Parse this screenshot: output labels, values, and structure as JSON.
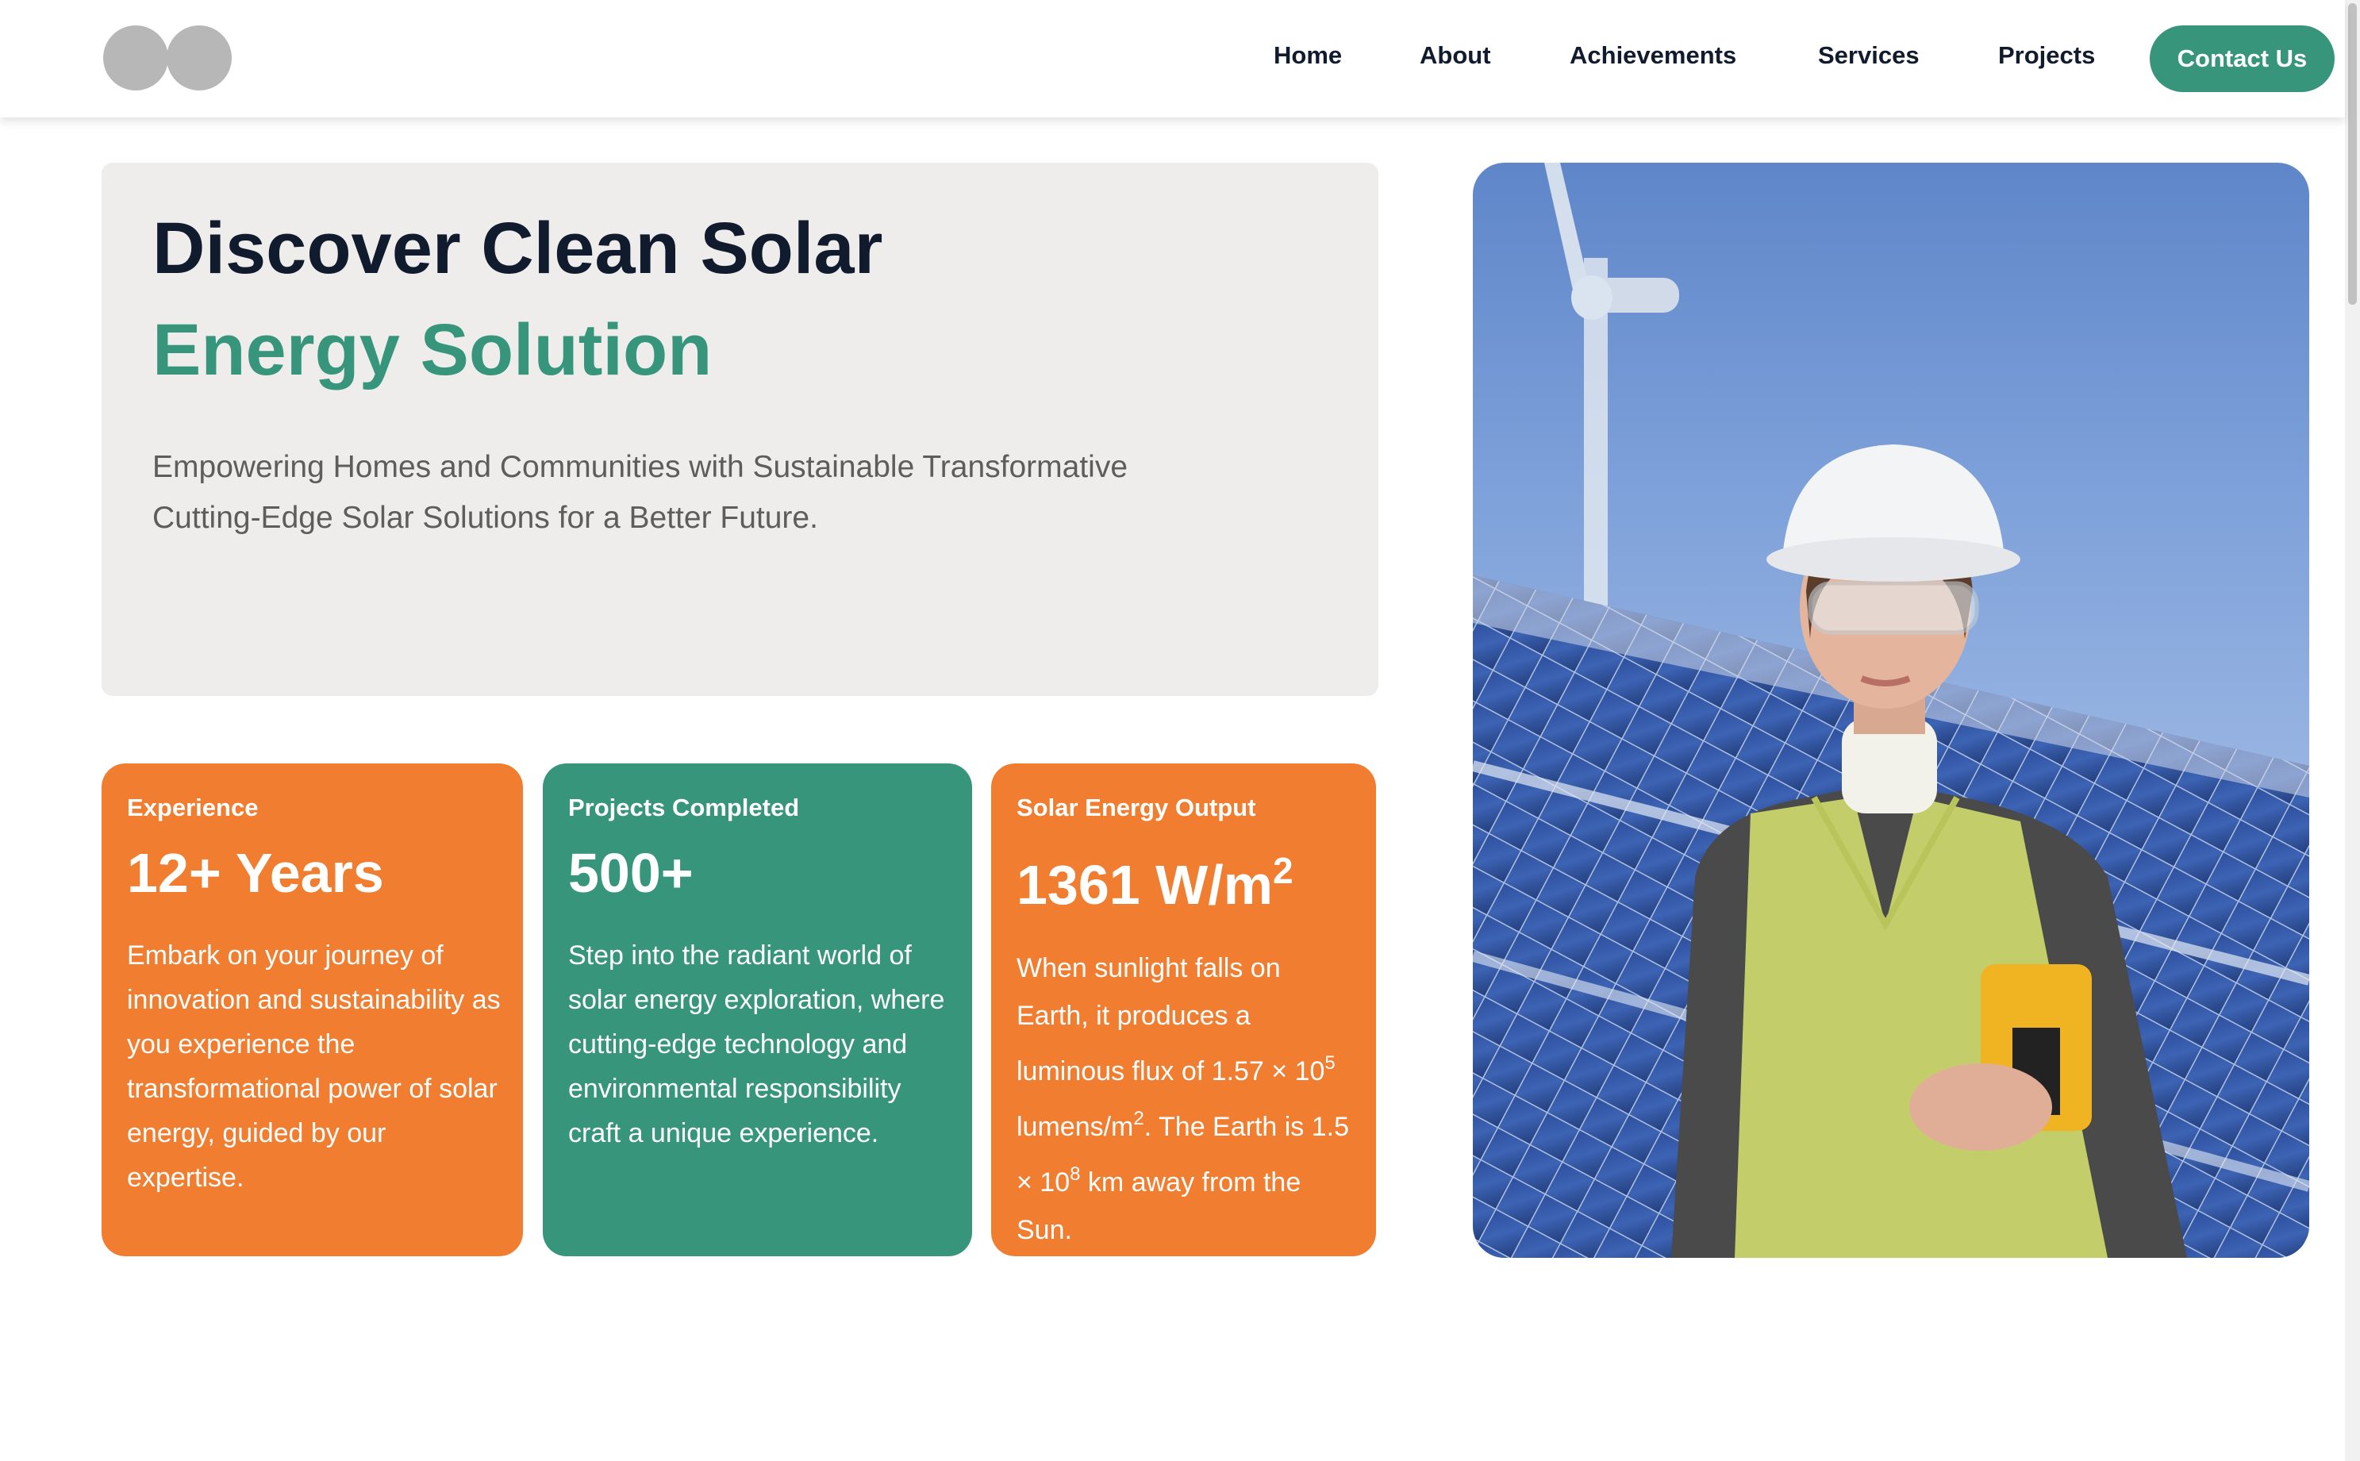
{
  "nav": {
    "links": [
      "Home",
      "About",
      "Achievements",
      "Services",
      "Projects"
    ],
    "contact_label": "Contact Us"
  },
  "hero": {
    "title_line1": "Discover Clean Solar",
    "title_line2": "Energy Solution",
    "description": "Empowering Homes and Communities with Sustainable Transformative Cutting-Edge Solar Solutions for a Better Future."
  },
  "stats": [
    {
      "label": "Experience",
      "value": "12+ Years",
      "description": "Embark on your journey of innovation and sustainability as you experience the transformational power of solar energy, guided by our expertise."
    },
    {
      "label": "Projects Completed",
      "value": "500+",
      "description": "Step into the radiant world of solar energy exploration, where cutting-edge technology and environmental responsibility craft a unique experience."
    },
    {
      "label": "Solar Energy Output",
      "value_main": "1361 W/m",
      "value_sup": "2",
      "desc_part1": "When sunlight falls on Earth, it produces a luminous flux of 1.57 × 10",
      "desc_sup1": "5",
      "desc_part2": " lumens/m",
      "desc_sup2": "2",
      "desc_part3": ". The Earth is 1.5 × 10",
      "desc_sup3": "8",
      "desc_part4": " km away from the Sun."
    }
  ],
  "colors": {
    "brand_green": "#37957b",
    "brand_orange": "#f07d30",
    "dark_text": "#111b2e",
    "hero_bg": "#efecec"
  },
  "icons": {
    "logo": "two-circle-logo-icon"
  }
}
